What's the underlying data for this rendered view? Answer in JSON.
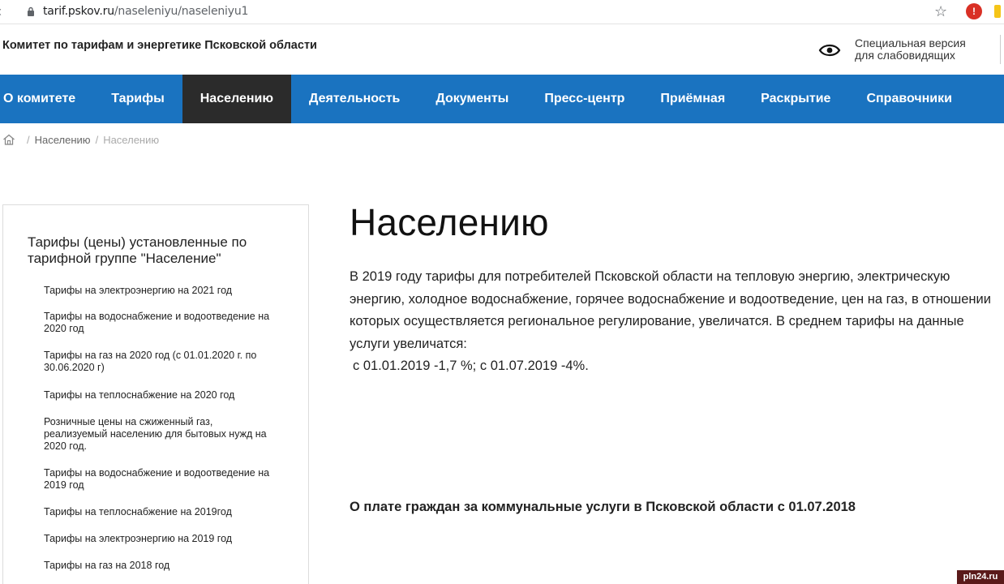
{
  "browser": {
    "url_host": "tarif.pskov.ru",
    "url_path": "/naseleniyu/naseleniyu1"
  },
  "header": {
    "site_title": "Комитет по тарифам и энергетике Псковской области",
    "special_version_line1": "Специальная версия",
    "special_version_line2": "для слабовидящих"
  },
  "nav": {
    "items": [
      {
        "label": "О комитете"
      },
      {
        "label": "Тарифы"
      },
      {
        "label": "Населению"
      },
      {
        "label": "Деятельность"
      },
      {
        "label": "Документы"
      },
      {
        "label": "Пресс-центр"
      },
      {
        "label": "Приёмная"
      },
      {
        "label": "Раскрытие"
      },
      {
        "label": "Справочники"
      }
    ],
    "active_color": "#2b2b2b",
    "bar_color": "#1a73c0"
  },
  "breadcrumb": {
    "items": [
      "Населению",
      "Населению"
    ]
  },
  "sidebar": {
    "title": "Тарифы (цены) установленные по тарифной группе \"Население\"",
    "items": [
      "Тарифы на электроэнергию на 2021 год",
      "Тарифы на водоснабжение и водоотведение на 2020 год",
      "Тарифы на газ на 2020 год (с 01.01.2020 г. по 30.06.2020 г)",
      "Тарифы на теплоснабжение на 2020 год",
      "Розничные цены на сжиженный газ, реализуемый населению для бытовых нужд на 2020 год.",
      "Тарифы на водоснабжение и водоотведение на 2019 год",
      "Тарифы на теплоснабжение на 2019год",
      "Тарифы на электроэнергию на 2019 год",
      "Тарифы на газ на 2018 год"
    ]
  },
  "main": {
    "title": "Населению",
    "intro": "В 2019  году тарифы для потребителей Псковской области  на тепловую энергию, электрическую энергию, холодное водоснабжение, горячее водоснабжение и водоотведение, цен на газ, в отношении которых осуществляется региональное регулирование,  увеличатся. В среднем тарифы на данные услуги увеличатся:",
    "rates": "с 01.01.2019  -1,7 %; с 01.07.2019 -4%.",
    "subheading": "О плате граждан за коммунальные услуги в Псковской области с 01.07.2018"
  },
  "watermark": "pln24.ru"
}
